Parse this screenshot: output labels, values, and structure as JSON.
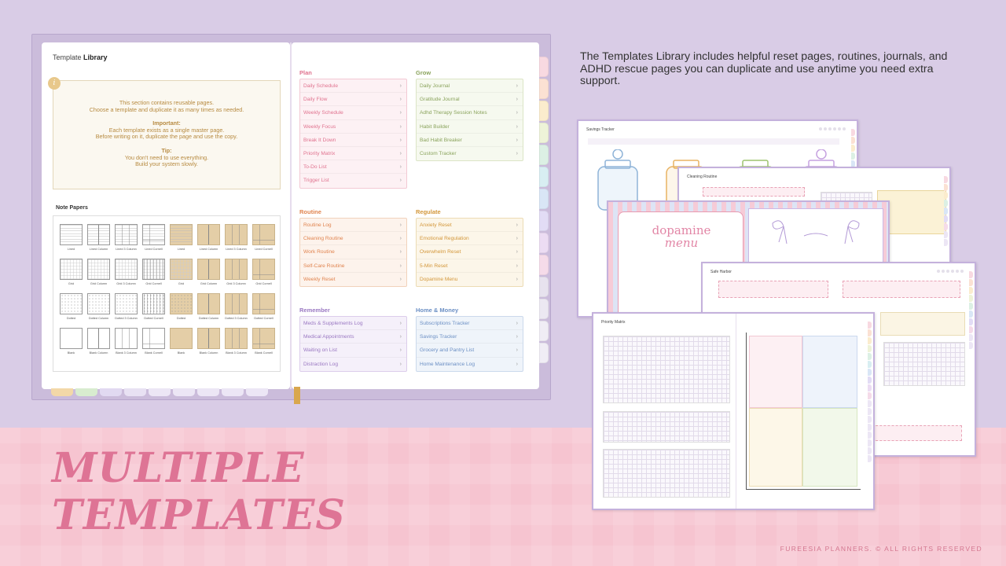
{
  "description": "The Templates Library includes helpful reset pages, routines, journals, and ADHD rescue pages you can duplicate and use anytime you need extra support.",
  "headline": {
    "line1": "MULTIPLE",
    "line2": "TEMPLATES"
  },
  "footer": "FUREESIA PLANNERS. © ALL RIGHTS RESERVED",
  "colors": {
    "background_top": "#d9cce6",
    "background_bottom": "#f6c4d0",
    "headline": "#de7495"
  },
  "library": {
    "title_prefix": "Template ",
    "title_bold": "Library",
    "info_icon": "i",
    "info_lines": [
      "This section contains reusable pages.",
      "Choose a template and duplicate it as many times as needed."
    ],
    "important_label": "Important:",
    "important_lines": [
      "Each template exists as a single master page.",
      "Before writing on it, duplicate the page and use the copy."
    ],
    "tip_label": "Tip:",
    "tip_lines": [
      "You don't need to use everything.",
      "Build your system slowly."
    ]
  },
  "note_papers": {
    "title": "Note Papers",
    "items": [
      {
        "label": "Lined",
        "style": "lined"
      },
      {
        "label": "Lined Column",
        "style": "lined-col"
      },
      {
        "label": "Lined 3 Column",
        "style": "lined-3col"
      },
      {
        "label": "Lined Cornell",
        "style": "lined-cornell"
      },
      {
        "label": "Lined",
        "style": "tan-lined"
      },
      {
        "label": "Lined Column",
        "style": "tan-col"
      },
      {
        "label": "Lined 3 Column",
        "style": "tan-3col"
      },
      {
        "label": "Lined Cornell",
        "style": "tan-cornell"
      },
      {
        "label": "Grid",
        "style": "grid"
      },
      {
        "label": "Grid Column",
        "style": "grid-col"
      },
      {
        "label": "Grid 3 Column",
        "style": "grid-3col"
      },
      {
        "label": "Grid Cornell",
        "style": "grid-cornell"
      },
      {
        "label": "Grid",
        "style": "tan-grid"
      },
      {
        "label": "Grid Column",
        "style": "tan-col"
      },
      {
        "label": "Grid 3 Column",
        "style": "tan-3col"
      },
      {
        "label": "Grid Cornell",
        "style": "tan-cornell"
      },
      {
        "label": "Dotted",
        "style": "dotted"
      },
      {
        "label": "Dotted Column",
        "style": "dotted-col"
      },
      {
        "label": "Dotted 3 Column",
        "style": "dotted-3col"
      },
      {
        "label": "Dotted Cornell",
        "style": "dotted-cornell"
      },
      {
        "label": "Dotted",
        "style": "tan-dotted"
      },
      {
        "label": "Dotted Column",
        "style": "tan-col"
      },
      {
        "label": "Dotted 3 Column",
        "style": "tan-3col"
      },
      {
        "label": "Dotted Cornell",
        "style": "tan-cornell"
      },
      {
        "label": "Blank",
        "style": "blank"
      },
      {
        "label": "Blank Column",
        "style": "blank-col"
      },
      {
        "label": "Blank 3 Column",
        "style": "blank-3col"
      },
      {
        "label": "Blank Cornell",
        "style": "blank-cornell"
      },
      {
        "label": "Blank",
        "style": "tan-blank"
      },
      {
        "label": "Blank Column",
        "style": "tan-col"
      },
      {
        "label": "Blank 3 Column",
        "style": "tan-3col"
      },
      {
        "label": "Blank Cornell",
        "style": "tan-cornell"
      }
    ]
  },
  "categories": {
    "plan": {
      "title": "Plan",
      "color": "#e0738f",
      "bg": "#fdf1f4",
      "border": "#f3c9d4",
      "items": [
        "Daily Schedule",
        "Daily Flow",
        "Weekly Schedule",
        "Weekly Focus",
        "Break It Down",
        "Priority Matrix",
        "To-Do List",
        "Trigger List"
      ]
    },
    "grow": {
      "title": "Grow",
      "color": "#8aa35c",
      "bg": "#f6f9ef",
      "border": "#dbe5c6",
      "items": [
        "Daily Journal",
        "Gratitude Journal",
        "Adhd Therapy Session Notes",
        "Habit Builder",
        "Bad Habit Breaker",
        "Custom Tracker"
      ]
    },
    "routine": {
      "title": "Routine",
      "color": "#e0844f",
      "bg": "#fdf3ec",
      "border": "#f2d2bb",
      "items": [
        "Routine Log",
        "Cleaning Routine",
        "Work Routine",
        "Self-Care Routine",
        "Weekly Reset"
      ]
    },
    "regulate": {
      "title": "Regulate",
      "color": "#d3973a",
      "bg": "#fcf6e9",
      "border": "#ecdcb4",
      "items": [
        "Anxiety Reset",
        "Emotional Regulation",
        "Overwhelm Reset",
        "5-Min Reset",
        "Dopamine Menu"
      ]
    },
    "remember": {
      "title": "Remember",
      "color": "#9a78c2",
      "bg": "#f5f0fa",
      "border": "#dccdeb",
      "items": [
        "Meds & Supplements Log",
        "Medical Appointments",
        "Waiting on List",
        "Distraction Log"
      ]
    },
    "home": {
      "title": "Home & Money",
      "color": "#6b8fc4",
      "bg": "#eff4fa",
      "border": "#cbd9ec",
      "items": [
        "Subscriptions Tracker",
        "Savings Tracker",
        "Grocery and Pantry List",
        "Home Maintenance Log"
      ]
    }
  },
  "previews": {
    "savings": "Savings Tracker",
    "cleaning": "Cleaning Routine",
    "dopamine_line1": "dopamine",
    "dopamine_line2": "menu",
    "self_care": "Safe Harbor",
    "priority": "Priority Matrix"
  }
}
